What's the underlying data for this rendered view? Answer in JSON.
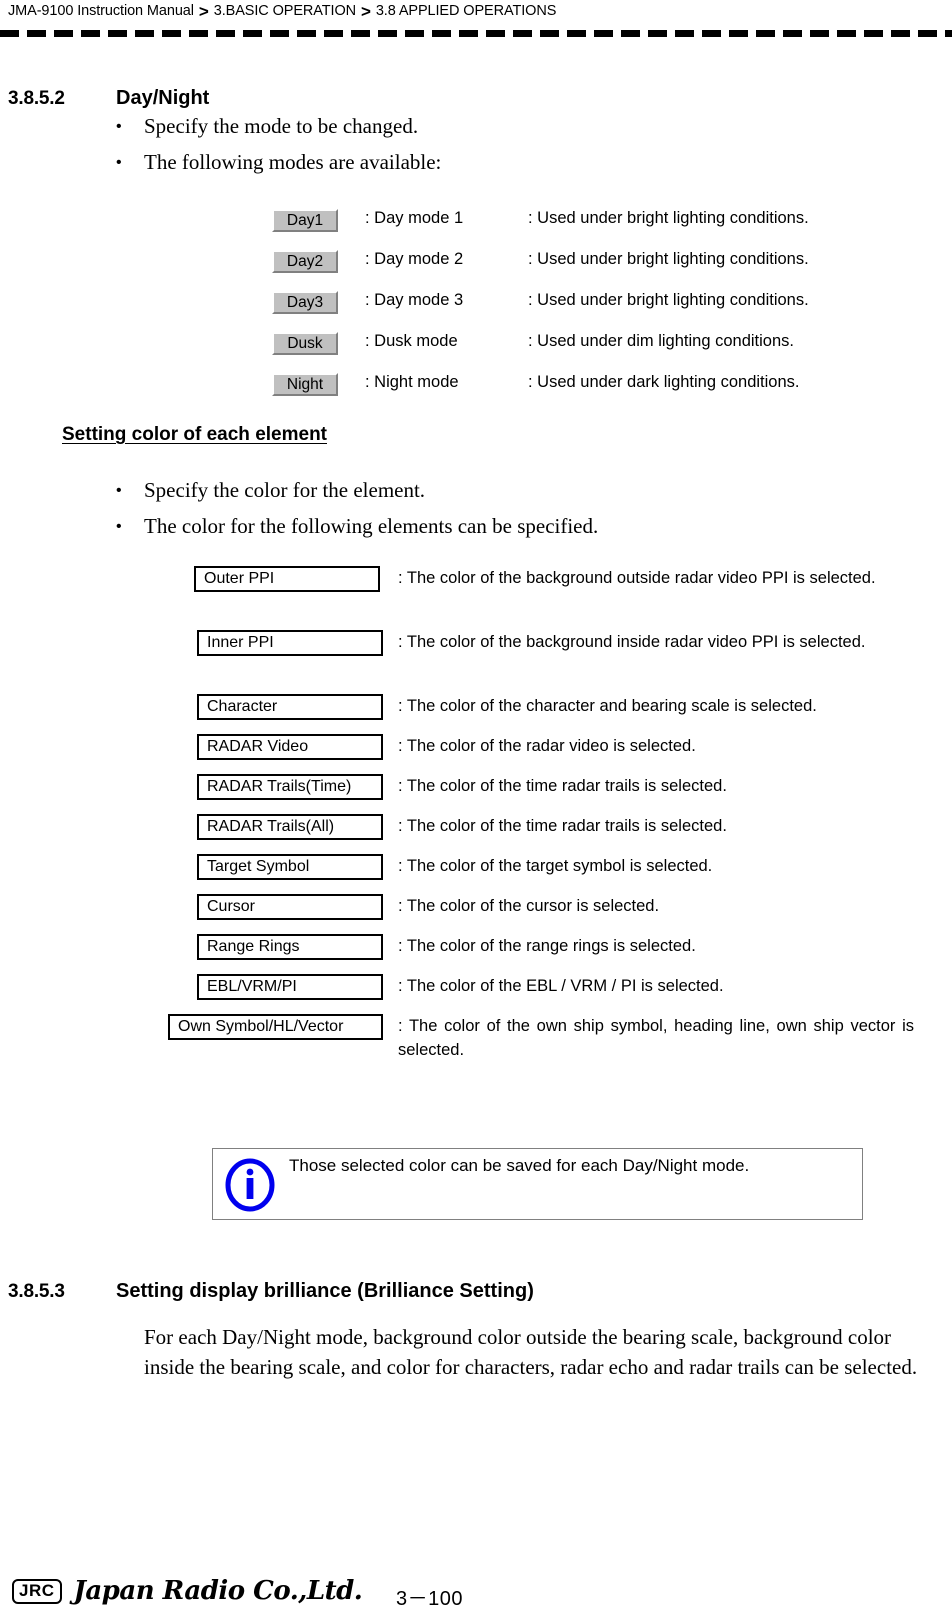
{
  "header": {
    "crumbs": [
      "JMA-9100 Instruction Manual",
      "3.BASIC OPERATION",
      "3.8  APPLIED OPERATIONS"
    ],
    "separator": ">"
  },
  "section_day_night": {
    "number": "3.8.5.2",
    "title": "Day/Night",
    "bullets": [
      "Specify the mode to be changed.",
      "The following modes are available:"
    ],
    "bullet_glyph": "•",
    "modes": [
      {
        "button": "Day1",
        "mode": ": Day mode 1",
        "usage": ": Used under bright lighting conditions."
      },
      {
        "button": "Day2",
        "mode": ": Day mode 2",
        "usage": ": Used under bright lighting conditions."
      },
      {
        "button": "Day3",
        "mode": ": Day mode 3",
        "usage": ": Used under bright lighting conditions."
      },
      {
        "button": "Dusk",
        "mode": ": Dusk mode",
        "usage": ": Used under dim lighting conditions."
      },
      {
        "button": "Night",
        "mode": ": Night mode",
        "usage": ": Used under dark lighting conditions."
      }
    ]
  },
  "section_element_color": {
    "subheading": "Setting color of each element",
    "bullets": [
      "Specify the color for the element.",
      "The color for the following elements can be specified."
    ],
    "elements": [
      {
        "label": "Outer PPI",
        "desc": ": The color of the background outside radar video PPI is selected."
      },
      {
        "label": "Inner PPI",
        "desc": ": The color of the background inside radar video PPI is selected."
      },
      {
        "label": "Character",
        "desc": ": The color of the character and bearing scale is selected."
      },
      {
        "label": "RADAR Video",
        "desc": ": The color of the radar video is selected."
      },
      {
        "label": "RADAR Trails(Time)",
        "desc": ": The color of the time radar trails is selected."
      },
      {
        "label": "RADAR Trails(All)",
        "desc": ": The color of the time radar trails is selected."
      },
      {
        "label": "Target Symbol",
        "desc": ": The color of the target symbol is selected."
      },
      {
        "label": "Cursor",
        "desc": ": The color of the cursor is selected."
      },
      {
        "label": "Range Rings",
        "desc": ": The color of the range rings is selected."
      },
      {
        "label": "EBL/VRM/PI",
        "desc": ": The color of the EBL / VRM / PI is selected."
      },
      {
        "label": "Own Symbol/HL/Vector",
        "desc": ": The color of the own ship symbol, heading line, own ship vector is selected."
      }
    ],
    "note": {
      "icon": "info-icon",
      "icon_color": "#0000ee",
      "text": "Those selected color can be saved for each Day/Night mode."
    }
  },
  "section_brilliance": {
    "number": "3.8.5.3",
    "title": "Setting display brilliance (Brilliance Setting)",
    "body": "For each Day/Night mode, background color outside the bearing scale, background color inside the bearing scale, and color for characters, radar echo and radar trails can be selected."
  },
  "footer": {
    "mark": "JRC",
    "company": "Japan Radio Co.,Ltd.",
    "page": "3－100"
  }
}
